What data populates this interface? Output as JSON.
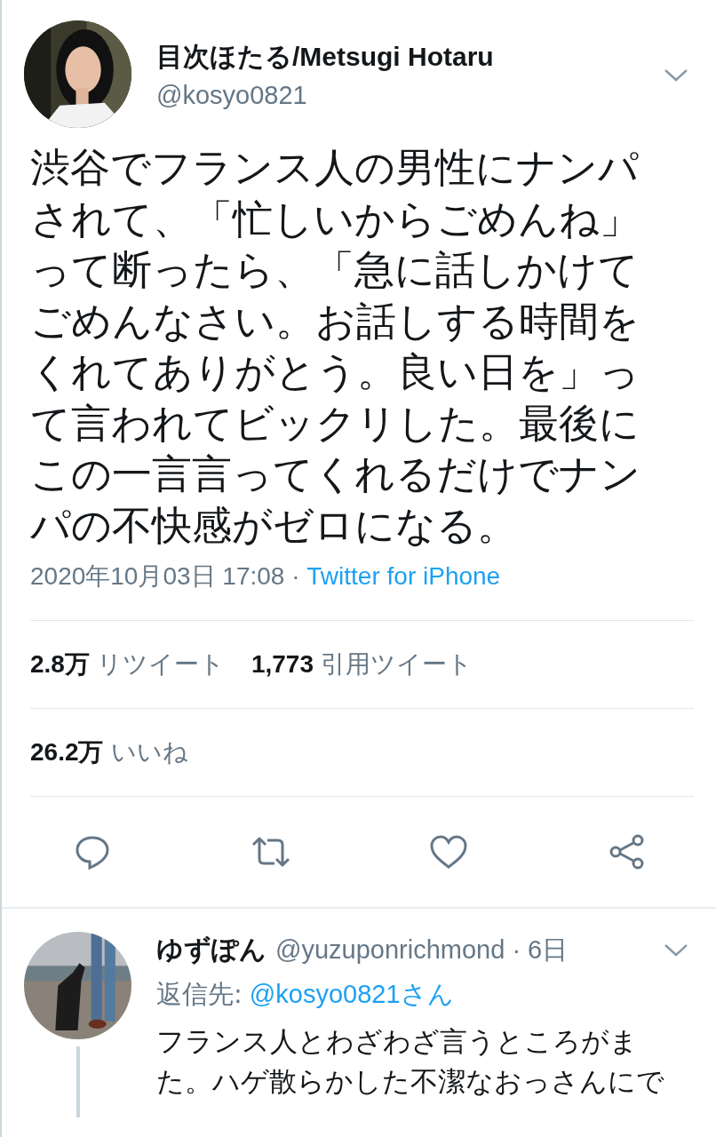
{
  "tweet": {
    "name": "目次ほたる/Metsugi Hotaru",
    "handle": "@kosyo0821",
    "text_lines": [
      "渋谷でフランス人の男性にナンパ",
      "されて、「忙しいからごめんね」",
      "って断ったら、「急に話しかけて",
      "ごめんなさい。お話しする時間を",
      "くれてありがとう。良い日を」っ",
      "て言われてビックリした。最後に",
      "この一言言ってくれるだけでナン",
      "パの不快感がゼロになる。"
    ],
    "timestamp": "2020年10月03日 17:08 · ",
    "source": "Twitter for iPhone",
    "stats": [
      {
        "count": "2.8万",
        "label": "リツイート"
      },
      {
        "count": "1,773",
        "label": "引用ツイート"
      }
    ],
    "likes": {
      "count": "26.2万",
      "label": "いいね"
    }
  },
  "reply": {
    "name": "ゆずぽん",
    "handle": "@yuzuponrichmond · 6日",
    "reply_to_label": "返信先:",
    "reply_to": "@kosyo0821さん",
    "text_lines": [
      "フランス人とわざわざ言うところがま",
      "た。ハゲ散らかした不潔なおっさんにで"
    ]
  }
}
